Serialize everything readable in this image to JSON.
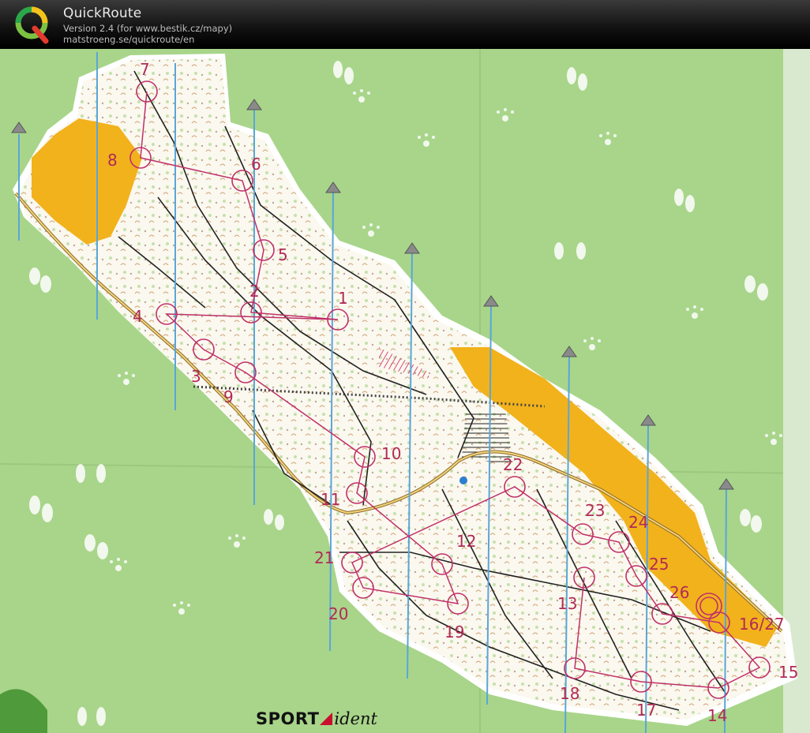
{
  "app": {
    "title": "QuickRoute",
    "version_line": "Version 2.4  (for www.bestik.cz/mapy)",
    "url_line": "matstroeng.se/quickroute/en",
    "logo_letter": "Q"
  },
  "colors": {
    "titlebar": "#111111",
    "map_green": "#a8d58a",
    "terrain_white": "#fbf8ef",
    "yellow_open": "#f2b21c",
    "course_purple": "#b12a55",
    "north_line": "#5aa6d8"
  },
  "map": {
    "controls": [
      {
        "label": "1"
      },
      {
        "label": "2"
      },
      {
        "label": "3"
      },
      {
        "label": "4"
      },
      {
        "label": "5"
      },
      {
        "label": "6"
      },
      {
        "label": "7"
      },
      {
        "label": "8"
      },
      {
        "label": "9"
      },
      {
        "label": "10"
      },
      {
        "label": "11"
      },
      {
        "label": "12"
      },
      {
        "label": "13"
      },
      {
        "label": "14"
      },
      {
        "label": "15"
      },
      {
        "label": "16/27"
      },
      {
        "label": "17"
      },
      {
        "label": "18"
      },
      {
        "label": "19"
      },
      {
        "label": "20"
      },
      {
        "label": "21"
      },
      {
        "label": "22"
      },
      {
        "label": "23"
      },
      {
        "label": "24"
      },
      {
        "label": "25"
      },
      {
        "label": "26"
      }
    ],
    "footprint_icons": [
      "footprint-icon",
      "paw-icon"
    ]
  },
  "brand": {
    "sport": "SPORT",
    "ident": "ident"
  }
}
